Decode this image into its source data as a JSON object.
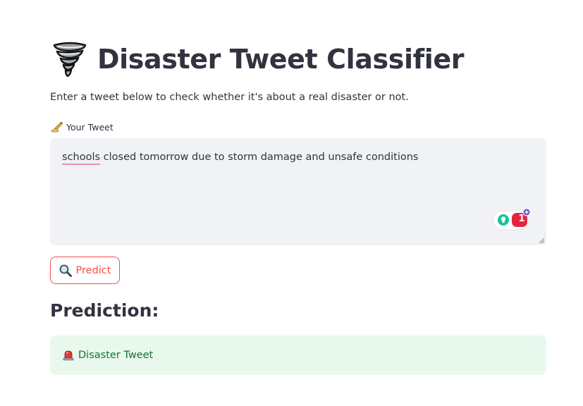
{
  "header": {
    "title": "Disaster Tweet Classifier",
    "title_icon": "tornado-icon",
    "subtitle": "Enter a tweet below to check whether it's about a real disaster or not."
  },
  "input": {
    "label": "Your Tweet",
    "label_icon": "writing-hand-icon",
    "value_first_word": "schools",
    "value_rest": " closed tomorrow due to storm damage and unsafe conditions",
    "grammarly_count": "1"
  },
  "predict_button": {
    "label": "Predict",
    "icon": "magnifier-icon"
  },
  "result": {
    "heading": "Prediction:",
    "icon": "siren-icon",
    "text": "Disaster Tweet"
  },
  "colors": {
    "accent": "#ff4b4b",
    "text": "#31333f",
    "input_bg": "#f0f2f6",
    "success_bg": "#e8f8ed",
    "success_text": "#177233"
  }
}
